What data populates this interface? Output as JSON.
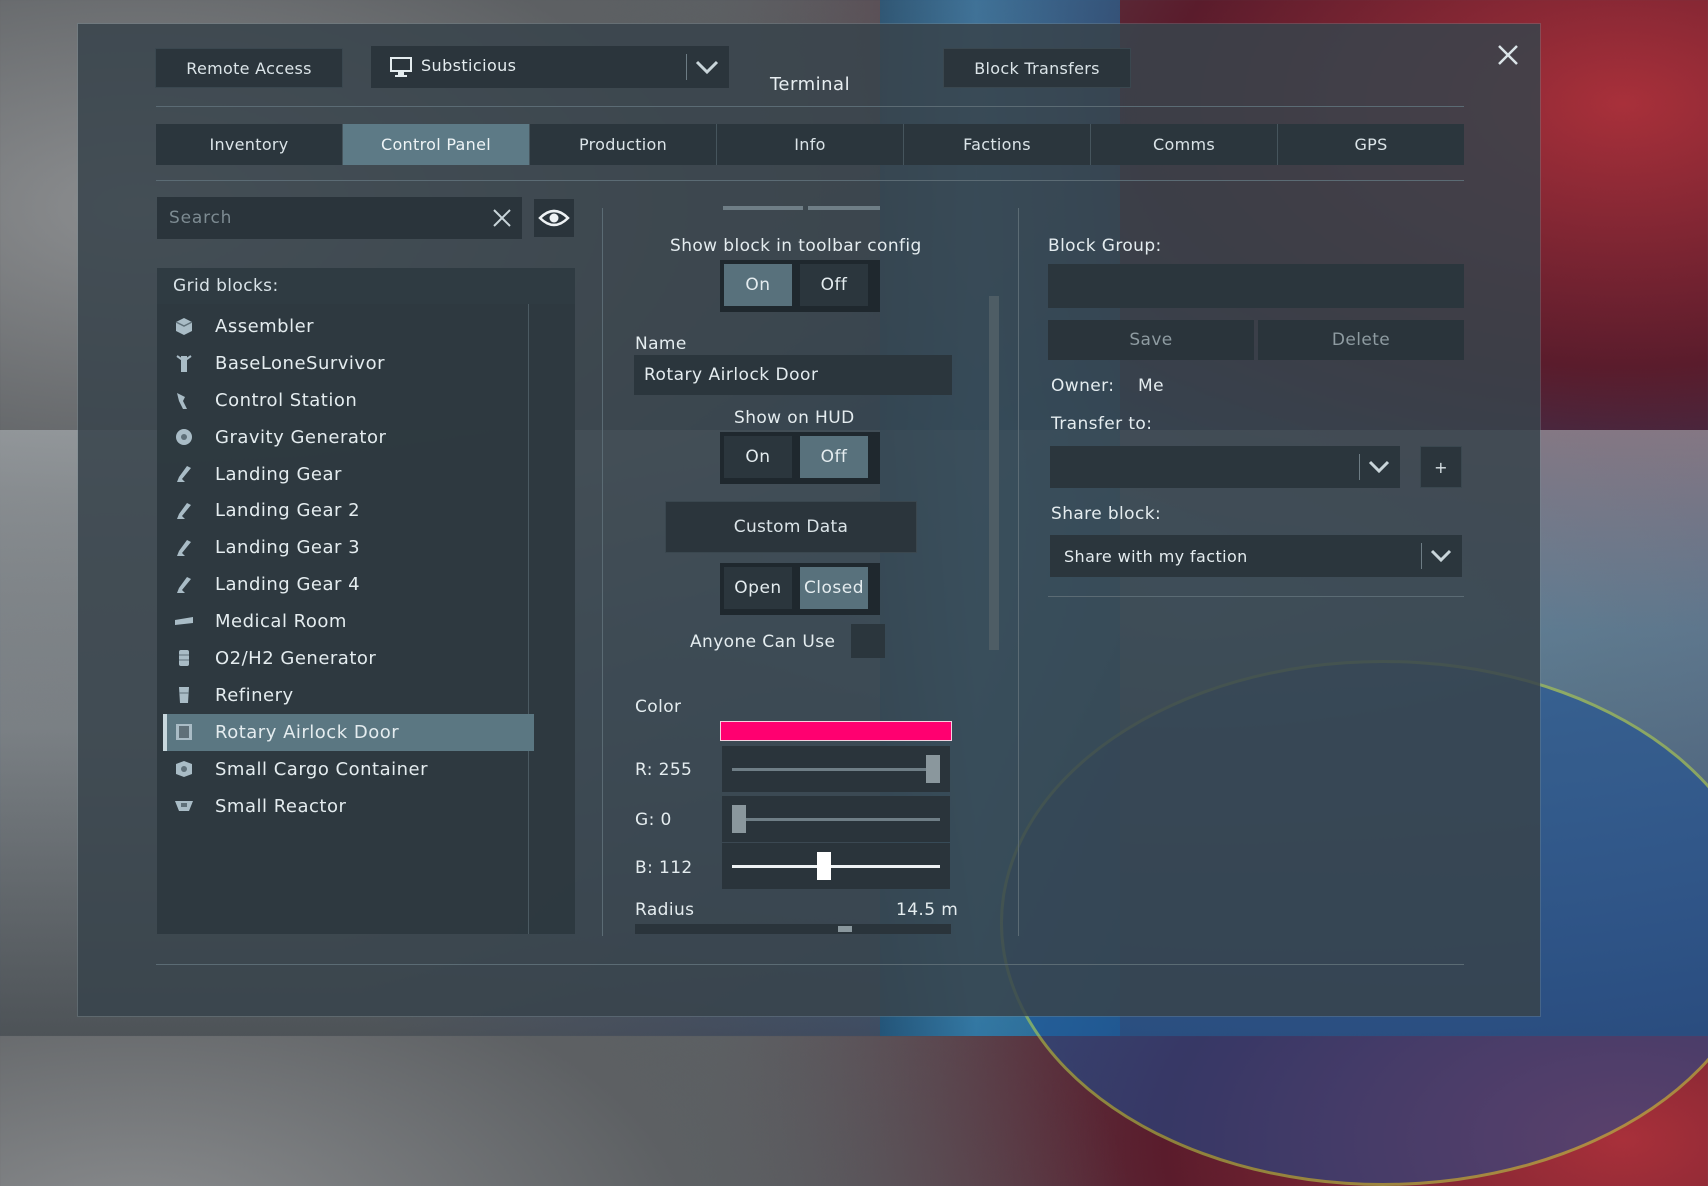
{
  "header": {
    "remote_access": "Remote Access",
    "grid_name": "Substicious",
    "title": "Terminal",
    "block_transfers": "Block Transfers"
  },
  "tabs": [
    {
      "label": "Inventory",
      "active": false
    },
    {
      "label": "Control Panel",
      "active": true
    },
    {
      "label": "Production",
      "active": false
    },
    {
      "label": "Info",
      "active": false
    },
    {
      "label": "Factions",
      "active": false
    },
    {
      "label": "Comms",
      "active": false
    },
    {
      "label": "GPS",
      "active": false
    }
  ],
  "search": {
    "placeholder": "Search"
  },
  "grid": {
    "heading": "Grid blocks:",
    "items": [
      {
        "label": "Assembler",
        "icon": "assembler-icon"
      },
      {
        "label": "BaseLoneSurvivor",
        "icon": "beacon-icon"
      },
      {
        "label": "Control Station",
        "icon": "control-station-icon"
      },
      {
        "label": "Gravity Generator",
        "icon": "gravity-generator-icon"
      },
      {
        "label": "Landing Gear",
        "icon": "landing-gear-icon"
      },
      {
        "label": "Landing Gear 2",
        "icon": "landing-gear-icon"
      },
      {
        "label": "Landing Gear 3",
        "icon": "landing-gear-icon"
      },
      {
        "label": "Landing Gear 4",
        "icon": "landing-gear-icon"
      },
      {
        "label": "Medical Room",
        "icon": "medical-room-icon"
      },
      {
        "label": "O2/H2 Generator",
        "icon": "generator-icon"
      },
      {
        "label": "Refinery",
        "icon": "refinery-icon"
      },
      {
        "label": "Rotary Airlock Door",
        "icon": "door-icon",
        "selected": true
      },
      {
        "label": "Small Cargo Container",
        "icon": "cargo-icon"
      },
      {
        "label": "Small Reactor",
        "icon": "reactor-icon"
      }
    ]
  },
  "config": {
    "toolbar_label": "Show block in toolbar config",
    "toolbar_on": "On",
    "toolbar_off": "Off",
    "name_label": "Name",
    "name_value": "Rotary Airlock Door",
    "hud_label": "Show on HUD",
    "hud_on": "On",
    "hud_off": "Off",
    "custom_data": "Custom Data",
    "open": "Open",
    "closed": "Closed",
    "anyone_can_use": "Anyone Can Use",
    "color_label": "Color",
    "color_hex": "#ff0070",
    "r_label": "R: 255",
    "g_label": "G: 0",
    "b_label": "B: 112",
    "r": 255,
    "g": 0,
    "b": 112,
    "radius_label": "Radius",
    "radius_value": "14.5 m"
  },
  "right": {
    "block_group_label": "Block Group:",
    "save": "Save",
    "delete": "Delete",
    "owner_label": "Owner:",
    "owner_value": "Me",
    "transfer_label": "Transfer to:",
    "plus": "+",
    "share_label": "Share block:",
    "share_value": "Share with my faction"
  }
}
